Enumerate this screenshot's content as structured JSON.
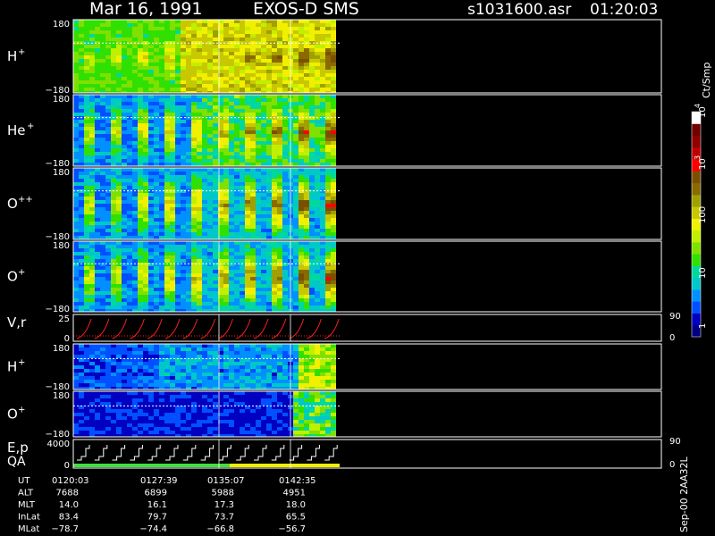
{
  "header": {
    "date": "Mar 16, 1991",
    "instrument": "EXOS-D SMS",
    "filename": "s1031600.asr",
    "time": "01:20:03"
  },
  "colorbar": {
    "unit": "Ct/Smp",
    "tick_labels": [
      "1",
      "10",
      "100",
      "10",
      "10"
    ],
    "tick_exponents": [
      "",
      "",
      "",
      "3",
      "4"
    ],
    "colors": [
      "#000080",
      "#0000c0",
      "#0050ff",
      "#0090ff",
      "#00c8c8",
      "#00d8a0",
      "#30e000",
      "#80e000",
      "#c0f000",
      "#f0f000",
      "#c8c800",
      "#a0a000",
      "#8a6a00",
      "#7a5000",
      "#ff0000",
      "#c00000",
      "#900000",
      "#700000",
      "#ffffff"
    ]
  },
  "panels": [
    {
      "label": "H",
      "sup": "+",
      "top": "180",
      "bottom": "−180"
    },
    {
      "label": "He",
      "sup": "+",
      "top": "180",
      "bottom": "−180"
    },
    {
      "label": "O",
      "sup": "++",
      "top": "180",
      "bottom": "−180"
    },
    {
      "label": "O",
      "sup": "+",
      "top": "180",
      "bottom": "−180"
    },
    {
      "label": "V,r",
      "sup": "",
      "top": "25",
      "bottom": "0",
      "right_top": "90",
      "right_bottom": "0"
    },
    {
      "label": "H",
      "sup": "+",
      "top": "180",
      "bottom": "−180"
    },
    {
      "label": "O",
      "sup": "+",
      "top": "180",
      "bottom": "−180"
    },
    {
      "label": "E,p",
      "sup": "",
      "label2": "QA",
      "top": "4000",
      "bottom": "0",
      "right_top": "90",
      "right_bottom": "0"
    }
  ],
  "chart_data": {
    "type": "heatmap",
    "x_times": [
      "0120:03",
      "0127:39",
      "0135:07",
      "0142:35"
    ],
    "ylim": [
      -180,
      180
    ],
    "colorbar_unit": "Ct/Smp",
    "colorbar_range": [
      1,
      10000
    ]
  },
  "table": {
    "rows": [
      {
        "label": "UT",
        "values": [
          "0120:03",
          "0127:39",
          "0135:07",
          "0142:35"
        ]
      },
      {
        "label": "ALT",
        "values": [
          "7688",
          "6899",
          "5988",
          "4951"
        ]
      },
      {
        "label": "MLT",
        "values": [
          "14.0",
          "16.1",
          "17.3",
          "18.0"
        ]
      },
      {
        "label": "InLat",
        "values": [
          "83.4",
          "79.7",
          "73.7",
          "65.5"
        ]
      },
      {
        "label": "MLat",
        "values": [
          "−78.7",
          "−74.4",
          "−66.8",
          "−56.7"
        ]
      }
    ]
  },
  "footer": {
    "id": "Sep-00 2AA32L"
  }
}
